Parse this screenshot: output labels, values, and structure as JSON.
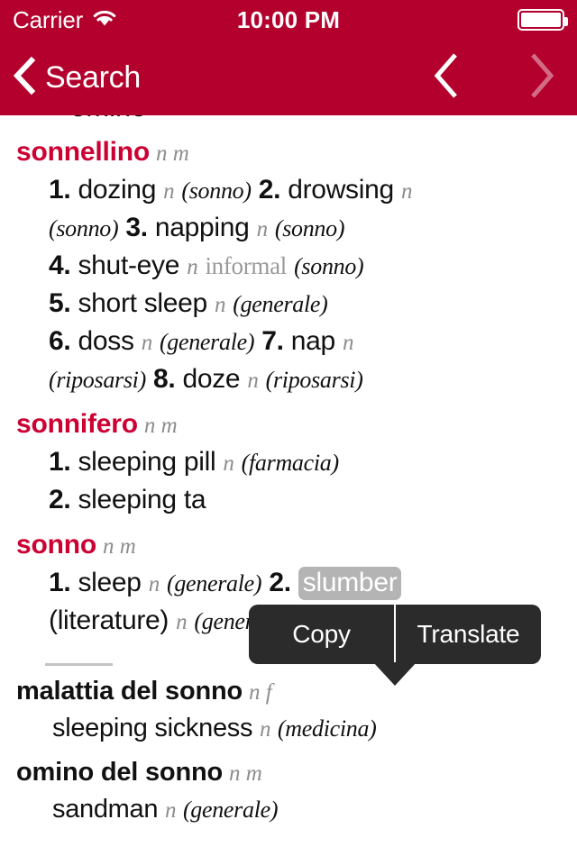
{
  "status_bar": {
    "carrier": "Carrier",
    "wifi_icon": "wifi-icon",
    "time": "10:00 PM",
    "battery_icon": "battery-full-icon"
  },
  "nav_bar": {
    "back_icon": "chevron-left-icon",
    "back_label": "Search",
    "prev_icon": "chevron-left-icon",
    "next_icon": "chevron-right-icon",
    "background_color": "#B3002D"
  },
  "theme": {
    "headword_color": "#CC0033",
    "nav_color": "#B3002D",
    "selection_color": "#b4b4b4",
    "popup_color": "#2b2b2b"
  },
  "clipped_top_text": "omino",
  "entries": [
    {
      "headword": "sonnellino",
      "pos": "n m",
      "lines": [
        [
          {
            "t": "num",
            "v": "1."
          },
          {
            "t": "gloss",
            "v": "dozing"
          },
          {
            "t": "g",
            "v": "n"
          },
          {
            "t": "ctx",
            "v": "(sonno)"
          },
          {
            "t": "num",
            "v": "2."
          },
          {
            "t": "gloss",
            "v": "drowsing"
          },
          {
            "t": "g",
            "v": "n"
          }
        ],
        [
          {
            "t": "ctx",
            "v": "(sonno)"
          },
          {
            "t": "num",
            "v": "3."
          },
          {
            "t": "gloss",
            "v": "napping"
          },
          {
            "t": "g",
            "v": "n"
          },
          {
            "t": "ctx",
            "v": "(sonno)"
          }
        ],
        [
          {
            "t": "num",
            "v": "4."
          },
          {
            "t": "gloss",
            "v": "shut-eye"
          },
          {
            "t": "g",
            "v": "n"
          },
          {
            "t": "reg",
            "v": "informal"
          },
          {
            "t": "ctx",
            "v": "(sonno)"
          }
        ],
        [
          {
            "t": "num",
            "v": "5."
          },
          {
            "t": "gloss",
            "v": "short sleep"
          },
          {
            "t": "g",
            "v": "n"
          },
          {
            "t": "ctx",
            "v": "(generale)"
          }
        ],
        [
          {
            "t": "num",
            "v": "6."
          },
          {
            "t": "gloss",
            "v": "doss"
          },
          {
            "t": "g",
            "v": "n"
          },
          {
            "t": "ctx",
            "v": "(generale)"
          },
          {
            "t": "num",
            "v": "7."
          },
          {
            "t": "gloss",
            "v": "nap"
          },
          {
            "t": "g",
            "v": "n"
          }
        ],
        [
          {
            "t": "ctx",
            "v": "(riposarsi)"
          },
          {
            "t": "num",
            "v": "8."
          },
          {
            "t": "gloss",
            "v": "doze"
          },
          {
            "t": "g",
            "v": "n"
          },
          {
            "t": "ctx",
            "v": "(riposarsi)"
          }
        ]
      ]
    },
    {
      "headword": "sonnifero",
      "pos": "n m",
      "lines": [
        [
          {
            "t": "num",
            "v": "1."
          },
          {
            "t": "gloss",
            "v": "sleeping pill"
          },
          {
            "t": "g",
            "v": "n"
          },
          {
            "t": "ctx",
            "v": "(farmacia)"
          }
        ],
        [
          {
            "t": "num",
            "v": "2."
          },
          {
            "t": "gloss",
            "v": "sleeping ta"
          }
        ]
      ]
    },
    {
      "headword": "sonno",
      "pos": "n m",
      "lines": [
        [
          {
            "t": "num",
            "v": "1."
          },
          {
            "t": "gloss",
            "v": "sleep"
          },
          {
            "t": "g",
            "v": "n"
          },
          {
            "t": "ctx",
            "v": "(generale)"
          },
          {
            "t": "num",
            "v": "2."
          },
          {
            "t": "sel",
            "v": "slumber"
          }
        ],
        [
          {
            "t": "plain",
            "v": "(literature)"
          },
          {
            "t": "g",
            "v": "n"
          },
          {
            "t": "ctx",
            "v": "(generale)"
          }
        ]
      ]
    }
  ],
  "compounds": [
    {
      "headword": "malattia del sonno",
      "pos": "n f",
      "lines": [
        [
          {
            "t": "gloss",
            "v": "sleeping sickness"
          },
          {
            "t": "g",
            "v": "n"
          },
          {
            "t": "ctx",
            "v": "(medicina)"
          }
        ]
      ]
    },
    {
      "headword": "omino del sonno",
      "pos": "n m",
      "lines": [
        [
          {
            "t": "gloss",
            "v": "sandman"
          },
          {
            "t": "g",
            "v": "n"
          },
          {
            "t": "ctx",
            "v": "(generale)"
          }
        ]
      ]
    }
  ],
  "edit_popup": {
    "copy_label": "Copy",
    "translate_label": "Translate"
  },
  "selected_text": "slumber"
}
